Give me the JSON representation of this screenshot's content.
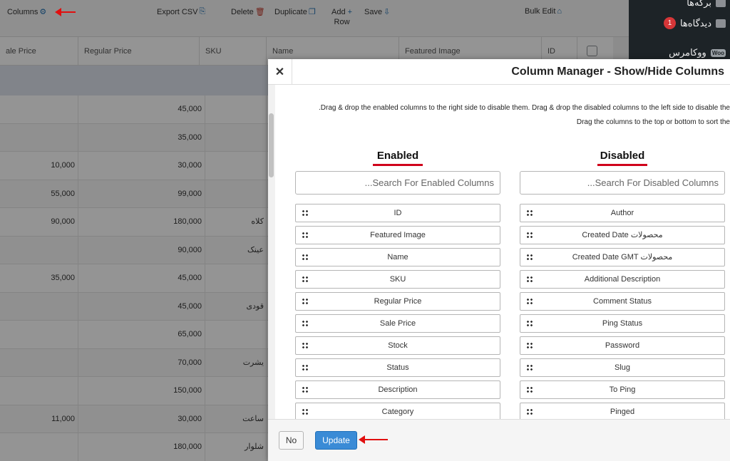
{
  "toolbar": {
    "columns_label": "Columns",
    "export_label": "Export CSV",
    "delete_label": "Delete",
    "duplicate_label": "Duplicate",
    "add_row_label_1": "Add",
    "add_row_label_2": "Row",
    "save_label": "Save",
    "bulk_edit_label": "Bulk Edit"
  },
  "table": {
    "headers": {
      "sale_price": "ale Price",
      "regular_price": "Regular Price",
      "sku": "SKU",
      "name": "Name",
      "featured_image": "Featured Image",
      "id": "ID"
    },
    "rows": [
      {
        "sale": "",
        "regular": "45,000",
        "name": ""
      },
      {
        "sale": "",
        "regular": "35,000",
        "name": ""
      },
      {
        "sale": "10,000",
        "regular": "30,000",
        "name": ""
      },
      {
        "sale": "55,000",
        "regular": "99,000",
        "name": ""
      },
      {
        "sale": "90,000",
        "regular": "180,000",
        "name": "کلاه"
      },
      {
        "sale": "",
        "regular": "90,000",
        "name": "عینک"
      },
      {
        "sale": "35,000",
        "regular": "45,000",
        "name": ""
      },
      {
        "sale": "",
        "regular": "45,000",
        "name": "قودی"
      },
      {
        "sale": "",
        "regular": "65,000",
        "name": ""
      },
      {
        "sale": "",
        "regular": "70,000",
        "name": "یشرت"
      },
      {
        "sale": "",
        "regular": "150,000",
        "name": ""
      },
      {
        "sale": "11,000",
        "regular": "30,000",
        "name": "ساعت"
      },
      {
        "sale": "",
        "regular": "180,000",
        "name": "شلوار"
      }
    ]
  },
  "sidebar": {
    "item1": "برگه‌ها",
    "item2": "دیدگاه‌ها",
    "item2_badge": "1",
    "item3": "ووکامرس",
    "wc_icon_text": "Woo"
  },
  "modal": {
    "close_symbol": "✕",
    "title": "Column Manager - Show/Hide Columns",
    "instruction_1": ".Drag & drop the enabled columns to the right side to disable them. Drag & drop the disabled columns to the left side to disable the",
    "instruction_2": "Drag the columns to the top or bottom to sort the",
    "enabled_title": "Enabled",
    "disabled_title": "Disabled",
    "enabled_search_placeholder": "...Search For Enabled Columns",
    "disabled_search_placeholder": "...Search For Disabled Columns",
    "enabled_columns": [
      "ID",
      "Featured Image",
      "Name",
      "SKU",
      "Regular Price",
      "Sale Price",
      "Stock",
      "Status",
      "Description",
      "Category"
    ],
    "disabled_columns": [
      "Author",
      "Created Date محصولات",
      "Created Date GMT محصولات",
      "Additional Description",
      "Comment Status",
      "Ping Status",
      "Password",
      "Slug",
      "To Ping",
      "Pinged"
    ],
    "no_label": "No",
    "update_label": "Update"
  },
  "colors": {
    "accent_blue": "#3a8bd6",
    "annotation_red": "#e10f0f",
    "sidebar_bg": "#1d2327"
  }
}
